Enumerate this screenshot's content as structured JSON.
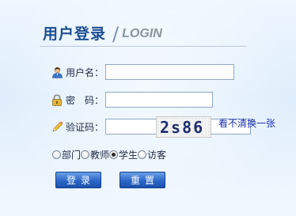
{
  "header": {
    "title_cn": "用户登录",
    "separator": "/",
    "title_en": "LOGIN"
  },
  "form": {
    "username": {
      "label": "用户名：",
      "value": "",
      "icon": "user-icon"
    },
    "password": {
      "label": "密　码：",
      "value": "",
      "icon": "lock-icon"
    },
    "captcha": {
      "label": "验证码：",
      "value": "",
      "icon": "pencil-icon",
      "image_text": "2s86",
      "refresh_link": "看不清换一张"
    }
  },
  "roles": {
    "options": [
      "部门",
      "教师",
      "学生",
      "访客"
    ],
    "selected": "学生"
  },
  "buttons": {
    "login": "登录",
    "reset": "重置"
  },
  "colors": {
    "title": "#1c4e94",
    "button": "#2b67c8",
    "link": "#1a2fb0"
  }
}
